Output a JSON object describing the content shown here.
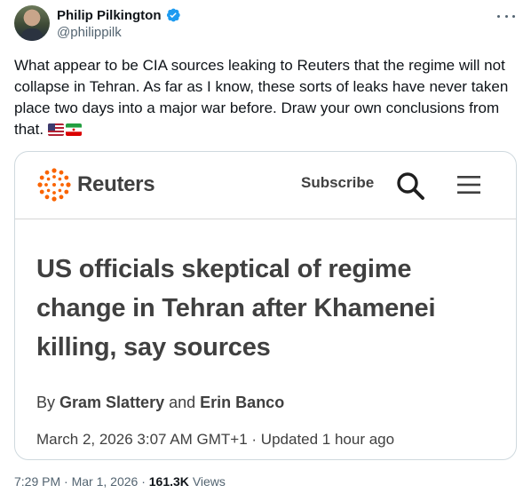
{
  "author": {
    "name": "Philip Pilkington",
    "handle": "@philippilk",
    "verified": true
  },
  "tweet": {
    "text": "What appear to be CIA sources leaking to Reuters that the regime will not collapse in Tehran. As far as I know, these sorts of leaks have never taken place two days into a major war before. Draw your own conclusions from that.",
    "flags": [
      "flag-us-icon",
      "flag-iran-icon"
    ]
  },
  "card": {
    "brand": "Reuters",
    "subscribe_label": "Subscribe",
    "headline": "US officials skeptical of regime change in Tehran after Khamenei killing, say sources",
    "byline_prefix": "By",
    "author1": "Gram Slattery",
    "byline_and": "and",
    "author2": "Erin Banco",
    "date": "March 2, 2026 3:07 AM GMT+1",
    "updated": "Updated 1 hour ago"
  },
  "meta": {
    "time": "7:29 PM",
    "date": "Mar 1, 2026",
    "views_count": "161.3K",
    "views_label": "Views"
  },
  "colors": {
    "reuters_orange": "#fa6400",
    "verified_blue": "#1d9bf0",
    "text_primary": "#0f1419",
    "text_secondary": "#536471",
    "border": "#cfd9de"
  }
}
